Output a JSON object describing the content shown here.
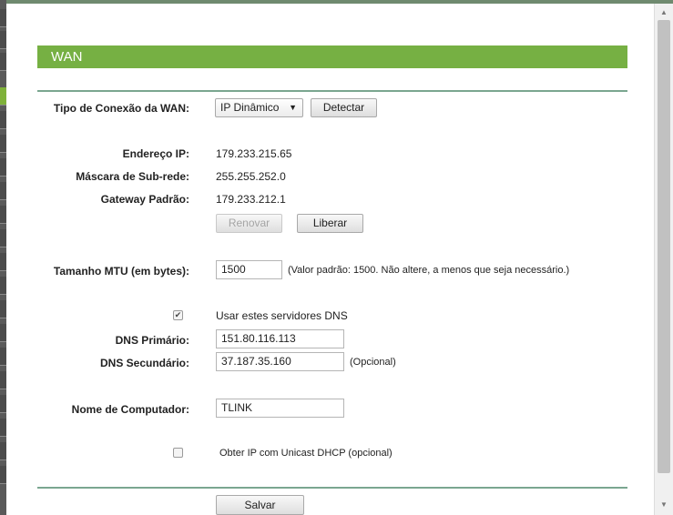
{
  "section_title": "WAN",
  "connection": {
    "label": "Tipo de Conexão da WAN:",
    "selected": "IP Dinâmico",
    "detect_label": "Detectar"
  },
  "status": {
    "ip_label": "Endereço IP:",
    "ip_value": "179.233.215.65",
    "mask_label": "Máscara de Sub-rede:",
    "mask_value": "255.255.252.0",
    "gateway_label": "Gateway Padrão:",
    "gateway_value": "179.233.212.1",
    "renew_label": "Renovar",
    "release_label": "Liberar"
  },
  "mtu": {
    "label": "Tamanho MTU (em bytes):",
    "value": "1500",
    "hint": "(Valor padrão: 1500. Não altere, a menos que seja necessário.)"
  },
  "dns": {
    "use_servers_label": "Usar estes servidores DNS",
    "use_servers_checked": true,
    "primary_label": "DNS Primário:",
    "primary_value": "151.80.116.113",
    "secondary_label": "DNS Secundário:",
    "secondary_value": "37.187.35.160",
    "optional_hint": "(Opcional)"
  },
  "host": {
    "label": "Nome de Computador:",
    "value": "TLINK"
  },
  "unicast": {
    "label": "Obter IP com Unicast DHCP (opcional)",
    "checked": false
  },
  "save_label": "Salvar",
  "colors": {
    "accent_green": "#76b043",
    "divider": "#7aa690"
  }
}
